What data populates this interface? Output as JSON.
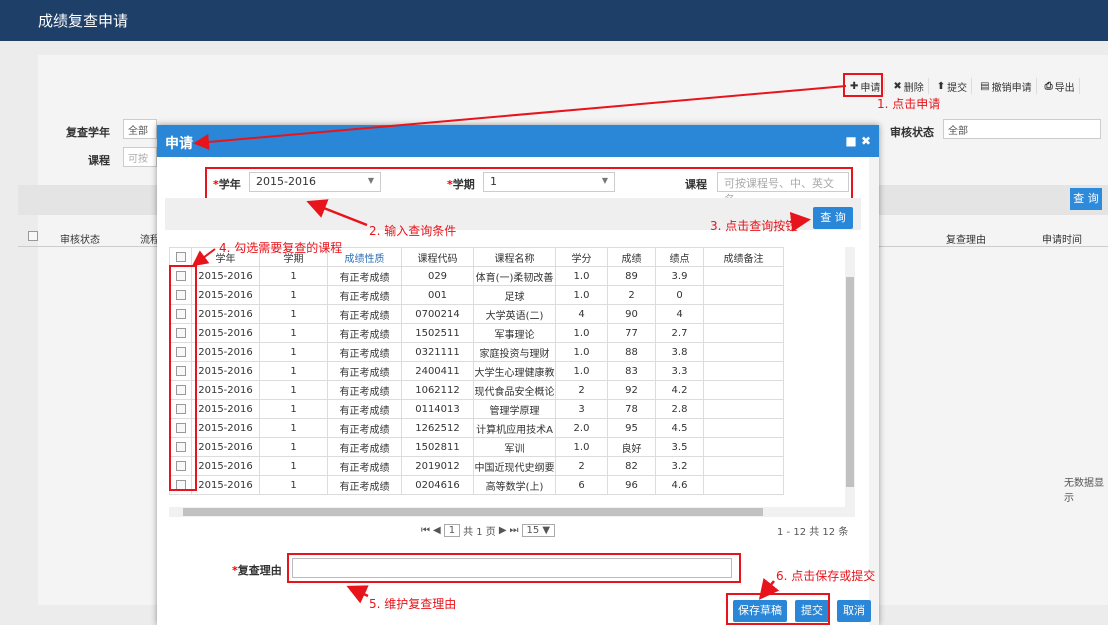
{
  "window": {
    "title": "成绩复查申请"
  },
  "toolbar": [
    {
      "icon": "plus-icon",
      "label": "申请"
    },
    {
      "icon": "delete-icon",
      "label": "删除"
    },
    {
      "icon": "upload-icon",
      "label": "提交"
    },
    {
      "icon": "revoke-icon",
      "label": "撤销申请"
    },
    {
      "icon": "print-icon",
      "label": "导出"
    }
  ],
  "filter": {
    "year_label": "复查学年",
    "year_value": "全部",
    "course_label": "课程",
    "course_placeholder": "可按",
    "status_label": "审核状态",
    "status_value": "全部",
    "search_label": "查 询"
  },
  "bg_table": {
    "headers": [
      "审核状态",
      "流程",
      "复查理由",
      "申请时间"
    ],
    "empty": "无数据显示"
  },
  "dialog": {
    "title": "申请",
    "year_label": "学年",
    "year_value": "2015-2016",
    "term_label": "学期",
    "term_value": "1",
    "course_label": "课程",
    "course_placeholder": "可按课程号、中、英文名",
    "search_label": "查 询",
    "columns": [
      "学年",
      "学期",
      "成绩性质",
      "课程代码",
      "课程名称",
      "学分",
      "成绩",
      "绩点",
      "成绩备注"
    ],
    "rows": [
      [
        "2015-2016",
        "1",
        "有正考成绩",
        "029",
        "体育(一)柔韧改善",
        "1.0",
        "89",
        "3.9",
        ""
      ],
      [
        "2015-2016",
        "1",
        "有正考成绩",
        "001",
        "足球",
        "1.0",
        "2",
        "0",
        ""
      ],
      [
        "2015-2016",
        "1",
        "有正考成绩",
        "0700214",
        "大学英语(二)",
        "4",
        "90",
        "4",
        ""
      ],
      [
        "2015-2016",
        "1",
        "有正考成绩",
        "1502511",
        "军事理论",
        "1.0",
        "77",
        "2.7",
        ""
      ],
      [
        "2015-2016",
        "1",
        "有正考成绩",
        "0321111",
        "家庭投资与理财",
        "1.0",
        "88",
        "3.8",
        ""
      ],
      [
        "2015-2016",
        "1",
        "有正考成绩",
        "2400411",
        "大学生心理健康教",
        "1.0",
        "83",
        "3.3",
        ""
      ],
      [
        "2015-2016",
        "1",
        "有正考成绩",
        "1062112",
        "现代食品安全概论",
        "2",
        "92",
        "4.2",
        ""
      ],
      [
        "2015-2016",
        "1",
        "有正考成绩",
        "0114013",
        "管理学原理",
        "3",
        "78",
        "2.8",
        ""
      ],
      [
        "2015-2016",
        "1",
        "有正考成绩",
        "1262512",
        "计算机应用技术A",
        "2.0",
        "95",
        "4.5",
        ""
      ],
      [
        "2015-2016",
        "1",
        "有正考成绩",
        "1502811",
        "军训",
        "1.0",
        "良好",
        "3.5",
        ""
      ],
      [
        "2015-2016",
        "1",
        "有正考成绩",
        "2019012",
        "中国近现代史纲要",
        "2",
        "82",
        "3.2",
        ""
      ],
      [
        "2015-2016",
        "1",
        "有正考成绩",
        "0204616",
        "高等数学(上)",
        "6",
        "96",
        "4.6",
        ""
      ]
    ],
    "pager": {
      "page": "1",
      "total_pages": "共 1 页",
      "page_size": "15",
      "summary": "1 - 12  共 12 条"
    },
    "reason_label": "复查理由",
    "buttons": {
      "save": "保存草稿",
      "submit": "提交",
      "cancel": "取消"
    }
  },
  "annotations": {
    "a1": "1. 点击申请",
    "a2": "2. 输入查询条件",
    "a3": "3. 点击查询按钮",
    "a4": "4. 勾选需要复查的课程",
    "a5": "5. 维护复查理由",
    "a6": "6. 点击保存或提交"
  },
  "colors": {
    "accent": "#2a86d7",
    "header": "#1e3f68",
    "annotation": "#e8141b"
  }
}
